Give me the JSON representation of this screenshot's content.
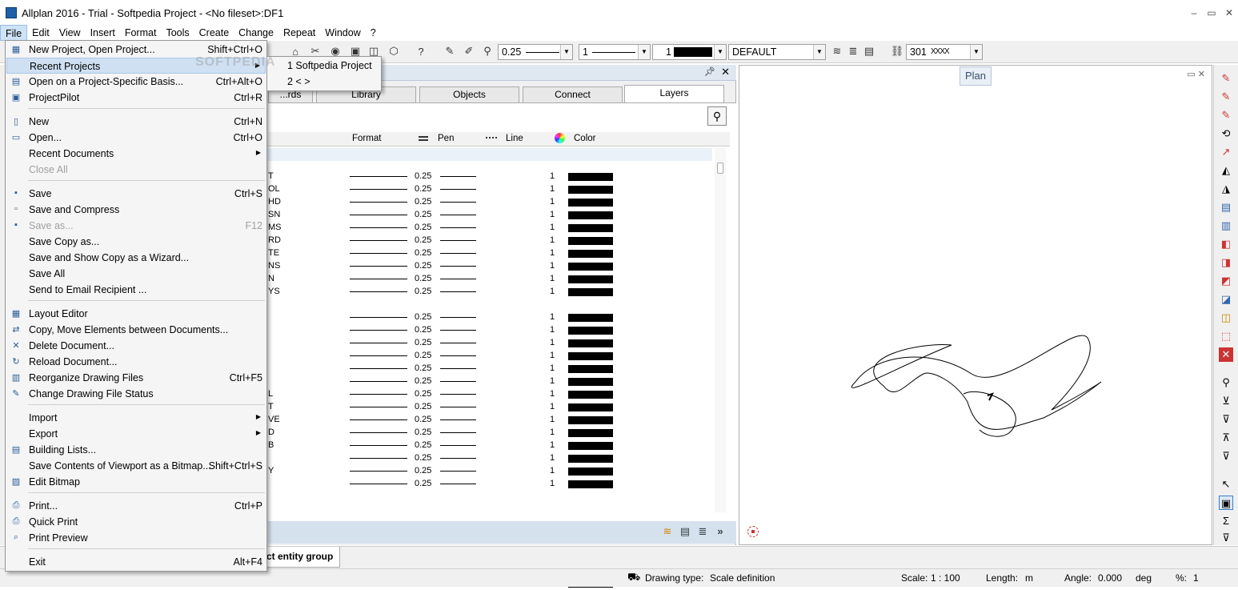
{
  "window": {
    "title": "Allplan 2016 - Trial - Softpedia Project - <No fileset>:DF1",
    "minimize": "–",
    "restore": "▭",
    "close": "✕"
  },
  "menubar": [
    "File",
    "Edit",
    "View",
    "Insert",
    "Format",
    "Tools",
    "Create",
    "Change",
    "Repeat",
    "Window",
    "?"
  ],
  "toolbar": {
    "pen_value": "0.25",
    "line_value": "1",
    "color_value": "1",
    "layer_value": "DEFAULT",
    "pattern_value": "301"
  },
  "file_menu": [
    {
      "label": "New Project, Open Project...",
      "shortcut": "Shift+Ctrl+O",
      "icon": "project-icon"
    },
    {
      "label": "Recent Projects",
      "shortcut": "",
      "submenu": true,
      "highlighted": true
    },
    {
      "label": "Open on a Project-Specific Basis...",
      "shortcut": "Ctrl+Alt+O",
      "icon": "open-basis-icon"
    },
    {
      "label": "ProjectPilot",
      "shortcut": "Ctrl+R",
      "icon": "projectpilot-icon"
    },
    {
      "separator": true
    },
    {
      "label": "New",
      "shortcut": "Ctrl+N",
      "icon": "new-icon"
    },
    {
      "label": "Open...",
      "shortcut": "Ctrl+O",
      "icon": "open-icon"
    },
    {
      "label": "Recent Documents",
      "shortcut": "",
      "submenu": true
    },
    {
      "label": "Close All",
      "shortcut": "",
      "disabled": true
    },
    {
      "separator": true
    },
    {
      "label": "Save",
      "shortcut": "Ctrl+S",
      "icon": "save-icon"
    },
    {
      "label": "Save and Compress",
      "shortcut": "",
      "icon": "save-compress-icon"
    },
    {
      "label": "Save as...",
      "shortcut": "F12",
      "disabled": true,
      "icon": "save-as-icon"
    },
    {
      "label": "Save Copy as...",
      "shortcut": ""
    },
    {
      "label": "Save and Show Copy as a Wizard...",
      "shortcut": ""
    },
    {
      "label": "Save All",
      "shortcut": ""
    },
    {
      "label": "Send to Email Recipient ...",
      "shortcut": ""
    },
    {
      "separator": true
    },
    {
      "label": "Layout Editor",
      "shortcut": "",
      "icon": "layout-editor-icon"
    },
    {
      "label": "Copy, Move Elements between Documents...",
      "shortcut": "",
      "icon": "copy-move-icon"
    },
    {
      "label": "Delete Document...",
      "shortcut": "",
      "icon": "delete-document-icon"
    },
    {
      "label": "Reload Document...",
      "shortcut": "",
      "icon": "reload-document-icon"
    },
    {
      "label": "Reorganize Drawing Files",
      "shortcut": "Ctrl+F5",
      "icon": "reorganize-icon"
    },
    {
      "label": "Change Drawing File Status",
      "shortcut": "",
      "icon": "change-status-icon"
    },
    {
      "separator": true
    },
    {
      "label": "Import",
      "shortcut": "",
      "submenu": true
    },
    {
      "label": "Export",
      "shortcut": "",
      "submenu": true
    },
    {
      "label": "Building Lists...",
      "shortcut": "",
      "icon": "building-lists-icon"
    },
    {
      "label": "Save Contents of Viewport as a Bitmap...",
      "shortcut": "Shift+Ctrl+S"
    },
    {
      "label": "Edit Bitmap",
      "shortcut": "",
      "icon": "edit-bitmap-icon"
    },
    {
      "separator": true
    },
    {
      "label": "Print...",
      "shortcut": "Ctrl+P",
      "icon": "print-icon"
    },
    {
      "label": "Quick Print",
      "shortcut": "",
      "icon": "quick-print-icon"
    },
    {
      "label": "Print Preview",
      "shortcut": "",
      "icon": "print-preview-icon"
    },
    {
      "separator": true
    },
    {
      "label": "Exit",
      "shortcut": "Alt+F4"
    }
  ],
  "recent_projects": [
    "1 Softpedia Project",
    "2 <      >"
  ],
  "palette": {
    "tabs": [
      "...rds",
      "Library",
      "Objects",
      "Connect",
      "Layers"
    ],
    "columns": [
      "Format",
      "Pen",
      "Line",
      "Color"
    ],
    "rows": [
      {
        "name": "T",
        "pen": "0.25",
        "line": "1"
      },
      {
        "name": "OL",
        "pen": "0.25",
        "line": "1"
      },
      {
        "name": "HD",
        "pen": "0.25",
        "line": "1"
      },
      {
        "name": "SN",
        "pen": "0.25",
        "line": "1"
      },
      {
        "name": "MS",
        "pen": "0.25",
        "line": "1"
      },
      {
        "name": "RD",
        "pen": "0.25",
        "line": "1"
      },
      {
        "name": "TE",
        "pen": "0.25",
        "line": "1"
      },
      {
        "name": "NS",
        "pen": "0.25",
        "line": "1"
      },
      {
        "name": "N",
        "pen": "0.25",
        "line": "1"
      },
      {
        "name": "YS",
        "pen": "0.25",
        "line": "1"
      },
      {
        "name": "",
        "pen": "0.25",
        "line": "1"
      },
      {
        "name": "",
        "pen": "0.25",
        "line": "1"
      },
      {
        "name": "",
        "pen": "0.25",
        "line": "1"
      },
      {
        "name": "",
        "pen": "0.25",
        "line": "1"
      },
      {
        "name": "",
        "pen": "0.25",
        "line": "1"
      },
      {
        "name": "",
        "pen": "0.25",
        "line": "1"
      },
      {
        "name": "L",
        "pen": "0.25",
        "line": "1"
      },
      {
        "name": "T",
        "pen": "0.25",
        "line": "1"
      },
      {
        "name": "VE",
        "pen": "0.25",
        "line": "1"
      },
      {
        "name": "D",
        "pen": "0.25",
        "line": "1"
      },
      {
        "name": "B",
        "pen": "0.25",
        "line": "1"
      },
      {
        "name": "",
        "pen": "0.25",
        "line": "1"
      },
      {
        "name": "Y",
        "pen": "0.25",
        "line": "1"
      },
      {
        "name": "",
        "pen": "0.25",
        "line": "1"
      },
      {
        "name": "",
        "pen": "0.25",
        "line": "1"
      }
    ]
  },
  "bottom_tab": "ct entity group",
  "viewport": {
    "plan_label": "Plan"
  },
  "status": {
    "drawing_type_label": "Drawing type:",
    "drawing_type_value": "Scale definition",
    "scale_label": "Scale:",
    "scale_value": "1 : 100",
    "length_label": "Length:",
    "length_value": "m",
    "angle_label": "Angle:",
    "angle_value": "0.000",
    "angle_unit": "deg",
    "percent_label": "%:",
    "percent_value": "1"
  },
  "watermark": "SOFTPEDIA"
}
